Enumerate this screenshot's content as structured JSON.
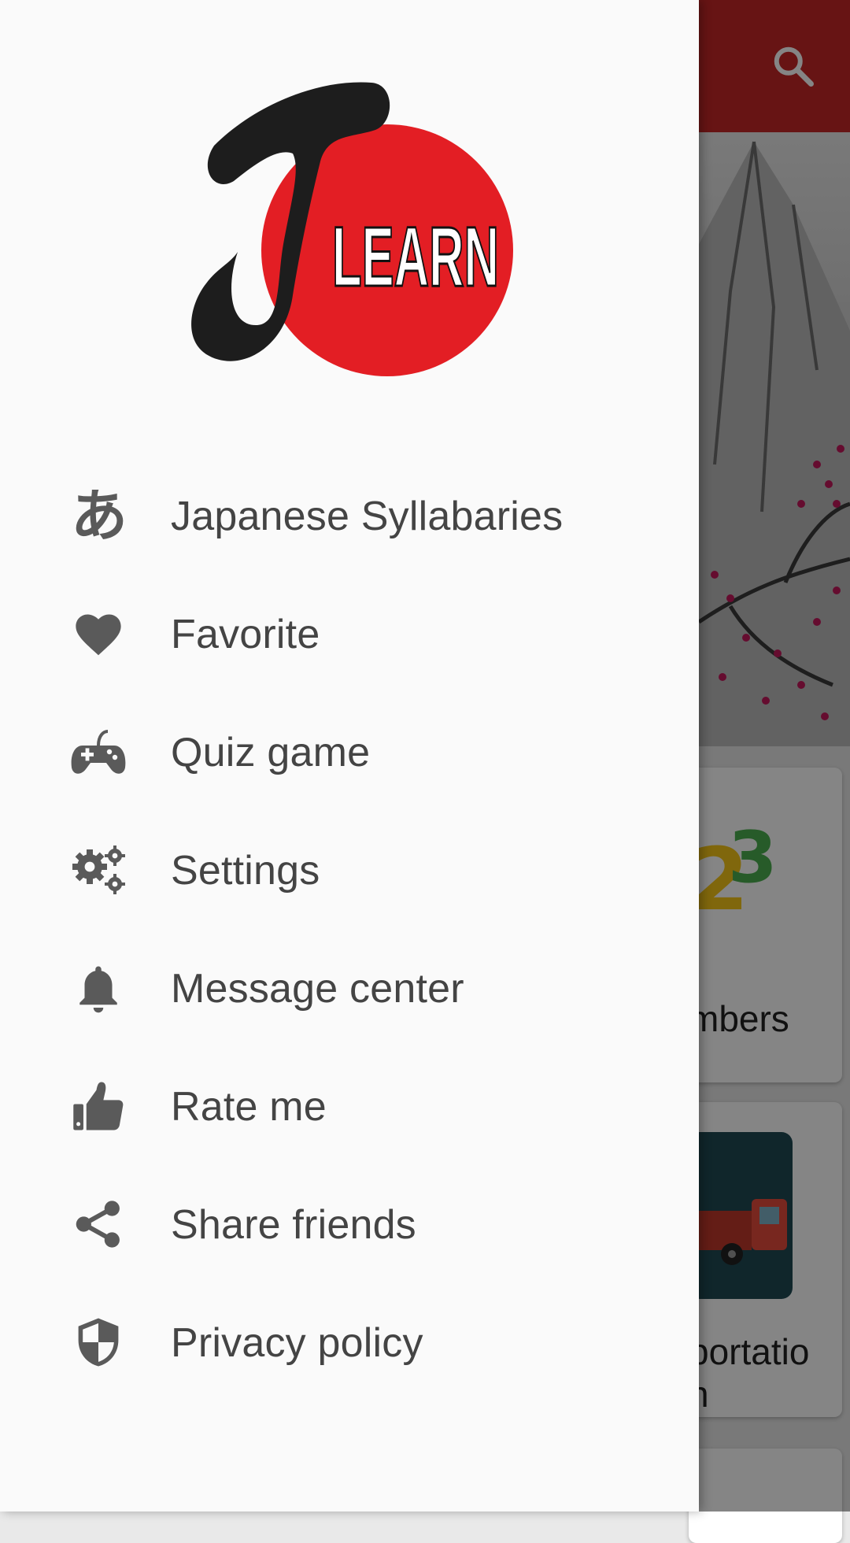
{
  "background": {
    "cards": [
      {
        "title": "mbers"
      },
      {
        "title": "portatio\nn"
      }
    ]
  },
  "drawer": {
    "logo": {
      "text": "LEARN",
      "letter": "J"
    },
    "items": [
      {
        "label": "Japanese Syllabaries",
        "icon": "hiragana-a-icon"
      },
      {
        "label": "Favorite",
        "icon": "heart-icon"
      },
      {
        "label": "Quiz game",
        "icon": "gamepad-icon"
      },
      {
        "label": "Settings",
        "icon": "gears-icon"
      },
      {
        "label": "Message center",
        "icon": "bell-icon"
      },
      {
        "label": "Rate me",
        "icon": "thumbs-up-icon"
      },
      {
        "label": "Share friends",
        "icon": "share-icon"
      },
      {
        "label": "Privacy policy",
        "icon": "shield-icon"
      }
    ]
  },
  "colors": {
    "app_bar": "#c62828",
    "logo_red": "#e31e24",
    "drawer_bg": "#fafafa",
    "icon_gray": "#5a5a5a",
    "text_dark": "#444444"
  }
}
